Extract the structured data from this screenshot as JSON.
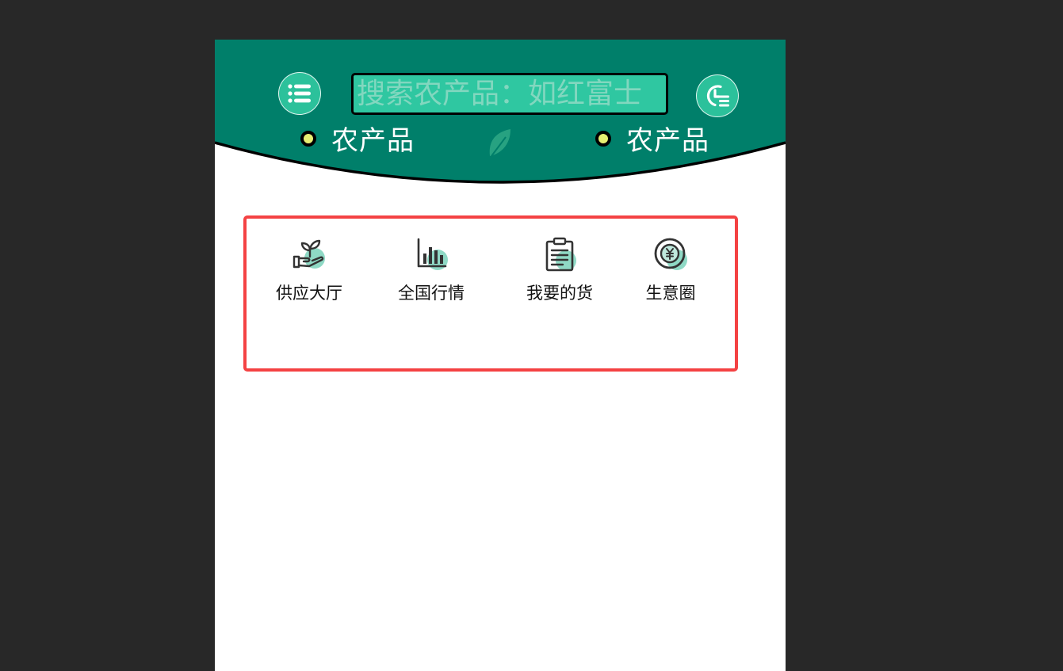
{
  "search": {
    "placeholder": "搜索农产品：如红富士"
  },
  "header": {
    "menu_icon": "menu-list-icon",
    "history_icon": "clock-list-icon",
    "categories": [
      {
        "label": "农产品"
      },
      {
        "label": "农产品"
      }
    ]
  },
  "nav": {
    "items": [
      {
        "label": "供应大厅",
        "icon": "hand-plant-icon"
      },
      {
        "label": "全国行情",
        "icon": "bar-chart-icon"
      },
      {
        "label": "我要的货",
        "icon": "clipboard-icon"
      },
      {
        "label": "生意圈",
        "icon": "yen-coin-icon"
      }
    ]
  },
  "colors": {
    "header": "#007f6a",
    "accent": "#2cc19b",
    "panel_border": "#f44243",
    "dot": "#e6ef72",
    "background": "#282828"
  }
}
